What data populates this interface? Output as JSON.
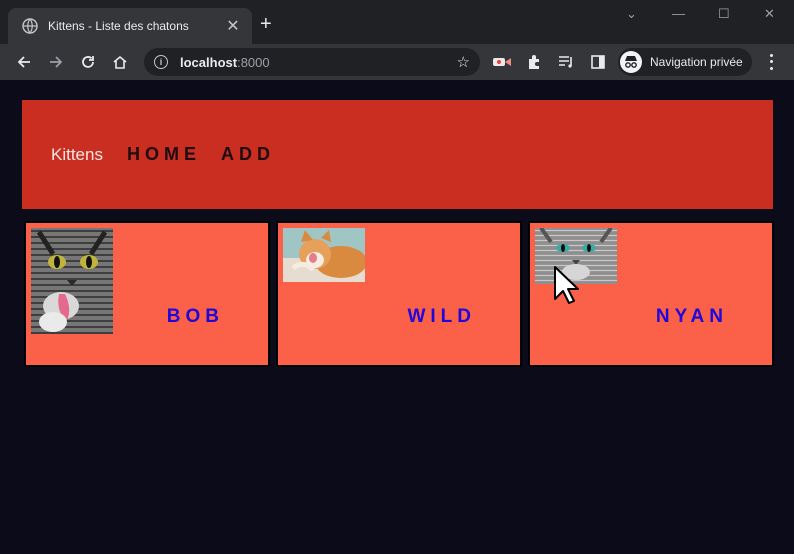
{
  "browser": {
    "tab_title": "Kittens - Liste des chatons",
    "tab_close": "✕",
    "new_tab": "+",
    "url_host": "localhost",
    "url_port": ":8000",
    "profile_label": "Navigation privée",
    "window_controls": [
      "⌄",
      "—",
      "☐",
      "✕"
    ]
  },
  "page": {
    "brand": "Kittens",
    "nav": [
      "HOME",
      "ADD"
    ],
    "kittens": [
      {
        "name": "BOB"
      },
      {
        "name": "WILD"
      },
      {
        "name": "NYAN"
      }
    ]
  },
  "colors": {
    "background": "#0c0b1a",
    "header": "#c92e21",
    "card": "#fb6049",
    "name": "#2006d8"
  }
}
